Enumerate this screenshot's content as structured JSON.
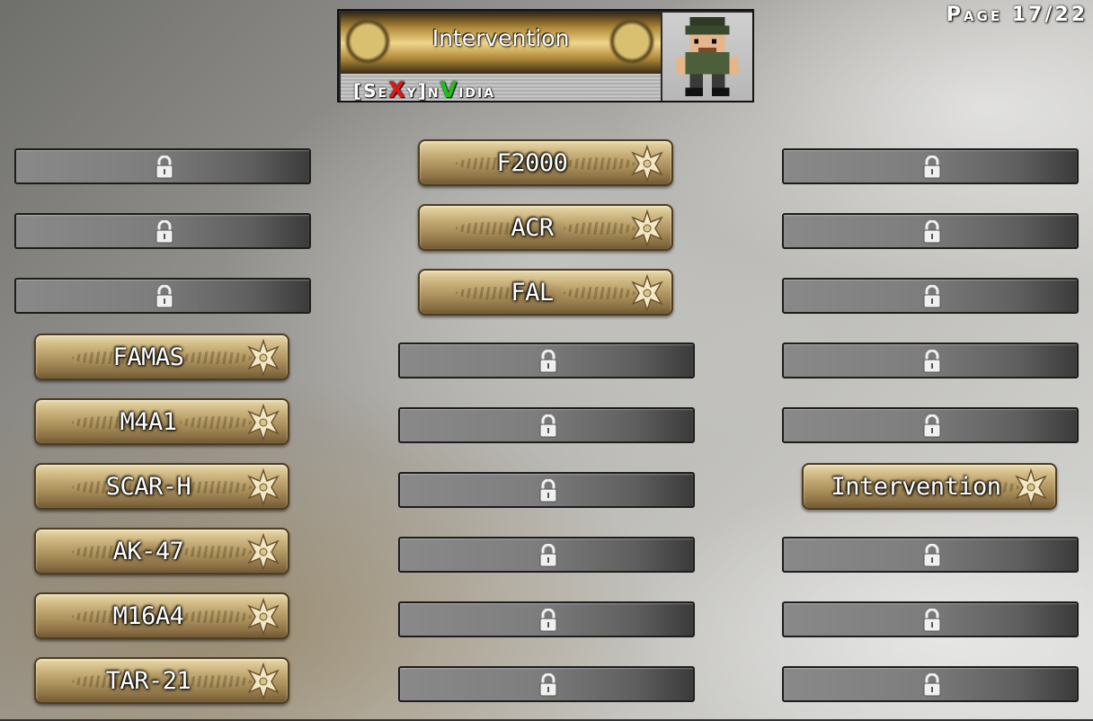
{
  "page_indicator": "Page 17/22",
  "player_card": {
    "title": "Intervention",
    "clan_tag_parts": [
      "[Se",
      "X",
      "y]n",
      "V",
      "idia"
    ],
    "emblem": "pixel-soldier-icon"
  },
  "columns": [
    {
      "slots": [
        {
          "state": "locked"
        },
        {
          "state": "locked"
        },
        {
          "state": "locked"
        },
        {
          "state": "unlocked",
          "label": "FAMAS"
        },
        {
          "state": "unlocked",
          "label": "M4A1"
        },
        {
          "state": "unlocked",
          "label": "SCAR-H"
        },
        {
          "state": "unlocked",
          "label": "AK-47"
        },
        {
          "state": "unlocked",
          "label": "M16A4"
        },
        {
          "state": "unlocked",
          "label": "TAR-21"
        }
      ]
    },
    {
      "slots": [
        {
          "state": "unlocked",
          "label": "F2000"
        },
        {
          "state": "unlocked",
          "label": "ACR"
        },
        {
          "state": "unlocked",
          "label": "FAL"
        },
        {
          "state": "locked"
        },
        {
          "state": "locked"
        },
        {
          "state": "locked"
        },
        {
          "state": "locked"
        },
        {
          "state": "locked"
        },
        {
          "state": "locked"
        }
      ]
    },
    {
      "slots": [
        {
          "state": "locked"
        },
        {
          "state": "locked"
        },
        {
          "state": "locked"
        },
        {
          "state": "locked"
        },
        {
          "state": "locked"
        },
        {
          "state": "unlocked",
          "label": "Intervention"
        },
        {
          "state": "locked"
        },
        {
          "state": "locked"
        },
        {
          "state": "locked"
        }
      ]
    }
  ],
  "icons": {
    "locked": "padlock-icon",
    "unlocked": "iron-cross-icon"
  },
  "colors": {
    "gold": "#c8b07a",
    "locked": "#7e7e7e",
    "tag_x": "#e01818",
    "tag_v": "#19c419"
  }
}
